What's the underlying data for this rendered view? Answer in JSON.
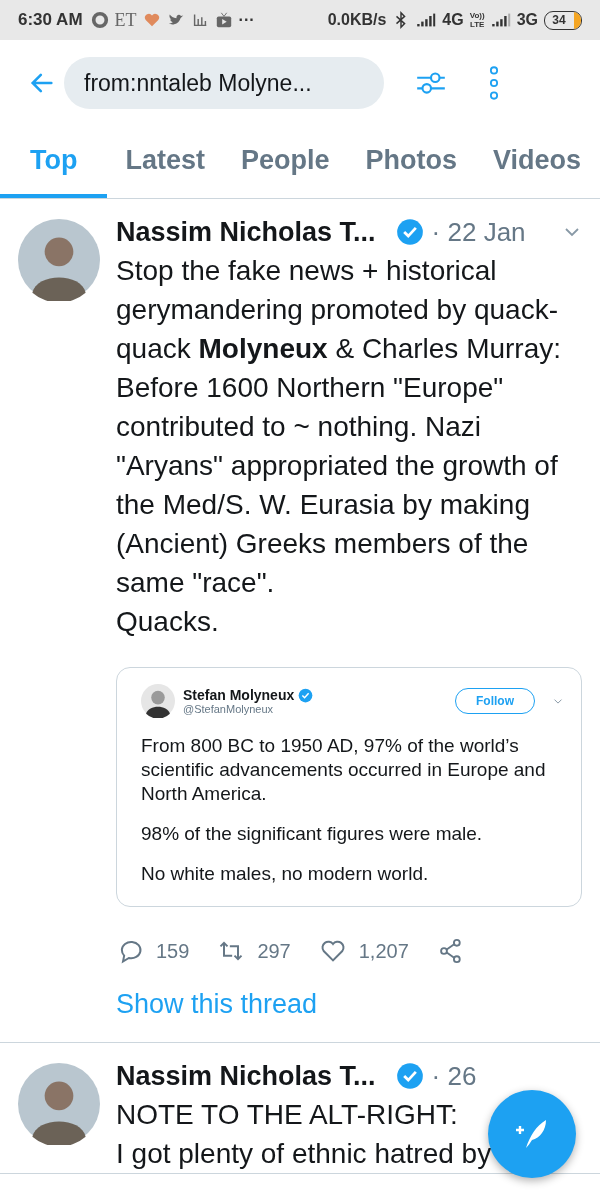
{
  "status_bar": {
    "time": "6:30 AM",
    "et": "ET",
    "more": "···",
    "speed": "0.0KB/s",
    "net1": "4G",
    "volte": [
      "Vo))",
      "LTE"
    ],
    "net2": "3G",
    "battery": {
      "text": "34"
    }
  },
  "search": {
    "value": "from:nntaleb Molyne..."
  },
  "tabs": [
    {
      "label": "Top",
      "selected": true
    },
    {
      "label": "Latest",
      "selected": false
    },
    {
      "label": "People",
      "selected": false
    },
    {
      "label": "Photos",
      "selected": false
    },
    {
      "label": "Videos",
      "selected": false
    }
  ],
  "tweets": [
    {
      "author": "Nassim Nicholas T...",
      "verified": true,
      "time": "· 22 Jan",
      "lines": [
        "Stop the fake news + historical gerymandering promoted by quack-quack **Molyneux** & Charles Murray:",
        "Before 1600 Northern \"Europe\" contributed to ~ nothing. Nazi \"Aryans\" appropriated the growth of the Med/S. W. Eurasia by making (Ancient) Greeks members of the same \"race\".",
        "Quacks."
      ],
      "quote": {
        "author": "Stefan Molyneux",
        "verified": true,
        "handle": "@StefanMolyneux",
        "follow": "Follow",
        "paragraphs": [
          "From 800 BC to 1950 AD, 97% of the world’s scientific advancements occurred in Europe and North America.",
          "98% of the significant figures were male.",
          "No white males, no modern world."
        ]
      },
      "replies": "159",
      "retweets": "297",
      "likes": "1,207",
      "thread_link": "Show this thread"
    },
    {
      "author": "Nassim Nicholas T...",
      "verified": true,
      "time": "· 26",
      "lines": [
        "NOTE TO THE ALT-RIGHT:",
        "I got plenty of ethnic hatred by"
      ]
    }
  ]
}
